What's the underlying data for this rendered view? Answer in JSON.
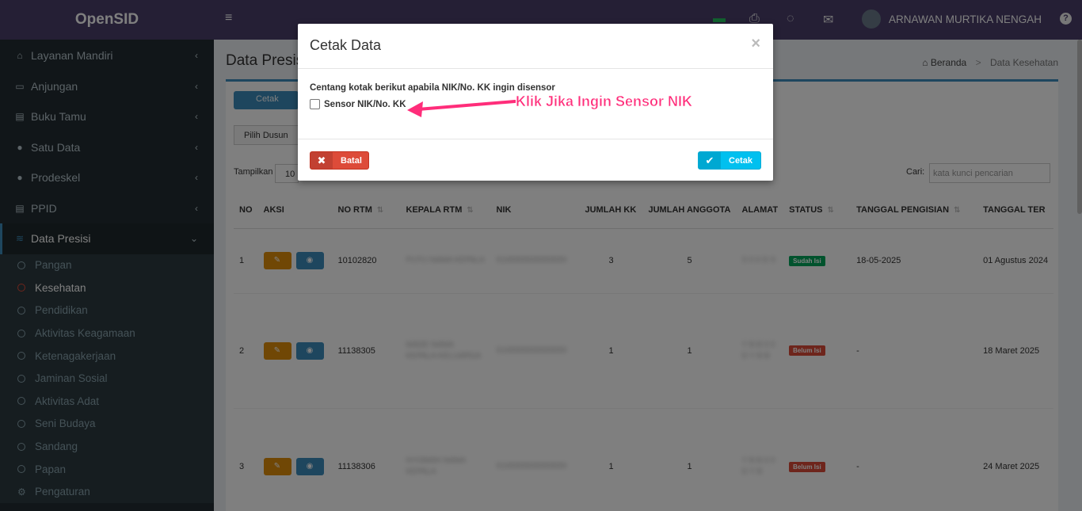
{
  "app": {
    "title": "OpenSID"
  },
  "sidebar": {
    "items": [
      {
        "label": "Layanan Mandiri",
        "icon": "home-icon"
      },
      {
        "label": "Anjungan",
        "icon": "monitor-icon"
      },
      {
        "label": "Buku Tamu",
        "icon": "book-icon"
      },
      {
        "label": "Satu Data",
        "icon": "globe-icon"
      },
      {
        "label": "Prodeskel",
        "icon": "globe-icon"
      },
      {
        "label": "PPID",
        "icon": "book-icon"
      },
      {
        "label": "Data Presisi",
        "icon": "database-icon"
      }
    ],
    "submenu": [
      "Pangan",
      "Kesehatan",
      "Pendidikan",
      "Aktivitas Keagamaan",
      "Ketenagakerjaan",
      "Jaminan Sosial",
      "Aktivitas Adat",
      "Seni Budaya",
      "Sandang",
      "Papan"
    ],
    "settings": "Pengaturan"
  },
  "topbar": {
    "user_name": "ARNAWAN MURTIKA NENGAH",
    "help": "?"
  },
  "page": {
    "title": "Data Presisi",
    "breadcrumb_home": "Beranda",
    "breadcrumb_current": "Data Kesehatan",
    "cetak_label": "Cetak",
    "dusun_label": "Pilih Dusun",
    "tampilkan_label": "Tampilkan",
    "tampilkan_value": "10",
    "cari_label": "Cari:",
    "cari_placeholder": "kata kunci pencarian"
  },
  "table": {
    "headers": [
      "NO",
      "AKSI",
      "NO RTM",
      "KEPALA RTM",
      "NIK",
      "JUMLAH KK",
      "JUMLAH ANGGOTA",
      "ALAMAT",
      "STATUS",
      "TANGGAL PENGISIAN",
      "TANGGAL TER"
    ],
    "rows": [
      {
        "no": "1",
        "no_rtm": "10102820",
        "kepala": "PUTU NAMA KEPALA",
        "nik": "5100000000000000",
        "jumlah_kk": "3",
        "jumlah_anggota": "5",
        "alamat": "S 0 0 D S",
        "status": "Sudah Isi",
        "tgl_isi": "18-05-2025",
        "tgl_ter": "01 Agustus 2024"
      },
      {
        "no": "2",
        "no_rtm": "11138305",
        "kepala": "MADE NAMA KEPALA KELUARGA",
        "nik": "5100000000000000",
        "jumlah_kk": "1",
        "jumlah_anggota": "1",
        "alamat": "Y B B 0 0 D Y B B",
        "status": "Belum Isi",
        "tgl_isi": "-",
        "tgl_ter": "18 Maret 2025"
      },
      {
        "no": "3",
        "no_rtm": "11138306",
        "kepala": "NYOMAN NAMA KEPALA",
        "nik": "5100000000000000",
        "jumlah_kk": "1",
        "jumlah_anggota": "1",
        "alamat": "Y B B 0 0 D Y B",
        "status": "Belum Isi",
        "tgl_isi": "-",
        "tgl_ter": "24 Maret 2025"
      }
    ]
  },
  "modal": {
    "title": "Cetak Data",
    "close": "×",
    "note": "Centang kotak berikut apabila NIK/No. KK ingin disensor",
    "checkbox_label": "Sensor NIK/No. KK",
    "cancel_label": "Batal",
    "ok_label": "Cetak"
  },
  "annotation": {
    "text": "Klik Jika Ingin Sensor NIK"
  },
  "colors": {
    "brand": "#4a3f6b",
    "sidebar": "#222d32",
    "danger": "#dd4b39",
    "info": "#00c0ef",
    "annotation": "#ff2d7a"
  }
}
